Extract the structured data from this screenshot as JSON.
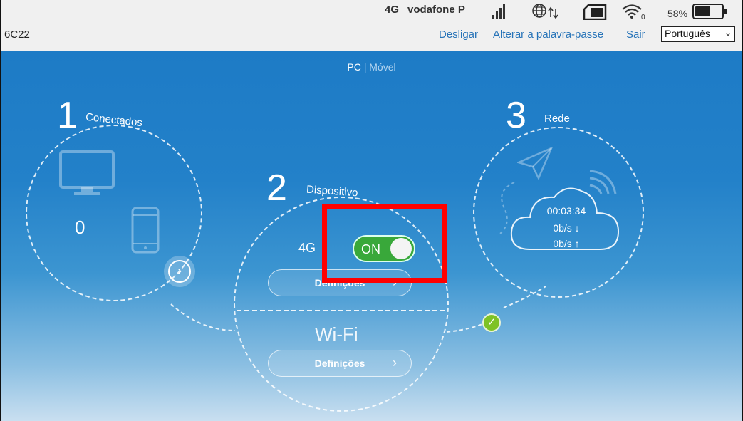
{
  "status_bar": {
    "network_type": "4G",
    "operator": "vodafone P",
    "battery_percent": "58%",
    "battery_level": 0.58
  },
  "header": {
    "device_name": "6C22",
    "links": {
      "disconnect": "Desligar",
      "change_password": "Alterar a palavra-passe",
      "logout": "Sair"
    },
    "language": "Português"
  },
  "view_toggle": {
    "pc": "PC",
    "separator": "|",
    "mobile": "Móvel"
  },
  "sections": {
    "connected": {
      "number": "1",
      "title": "Conectados",
      "count": "0"
    },
    "device": {
      "number": "2",
      "title": "Dispositivo",
      "network_label": "4G",
      "toggle_label": "ON",
      "toggle_state": true,
      "settings_button": "Definições",
      "wifi_label": "Wi-Fi",
      "wifi_settings_button": "Definições"
    },
    "network": {
      "number": "3",
      "title": "Rede",
      "duration": "00:03:34",
      "download": "0b/s ↓",
      "upload": "0b/s ↑"
    }
  },
  "icons": {
    "signal": "signal-bars-icon",
    "globe": "globe-data-icon",
    "sim": "sim-card-icon",
    "wifi": "wifi-icon",
    "battery": "battery-icon",
    "monitor": "monitor-icon",
    "phone": "phone-icon",
    "plane": "paper-plane-icon",
    "cloud": "cloud-icon",
    "check": "check-icon"
  },
  "colors": {
    "link": "#2673b8",
    "toggle_on": "#39a83a",
    "highlight": "#ff0000",
    "status_ok": "#7ec225"
  }
}
